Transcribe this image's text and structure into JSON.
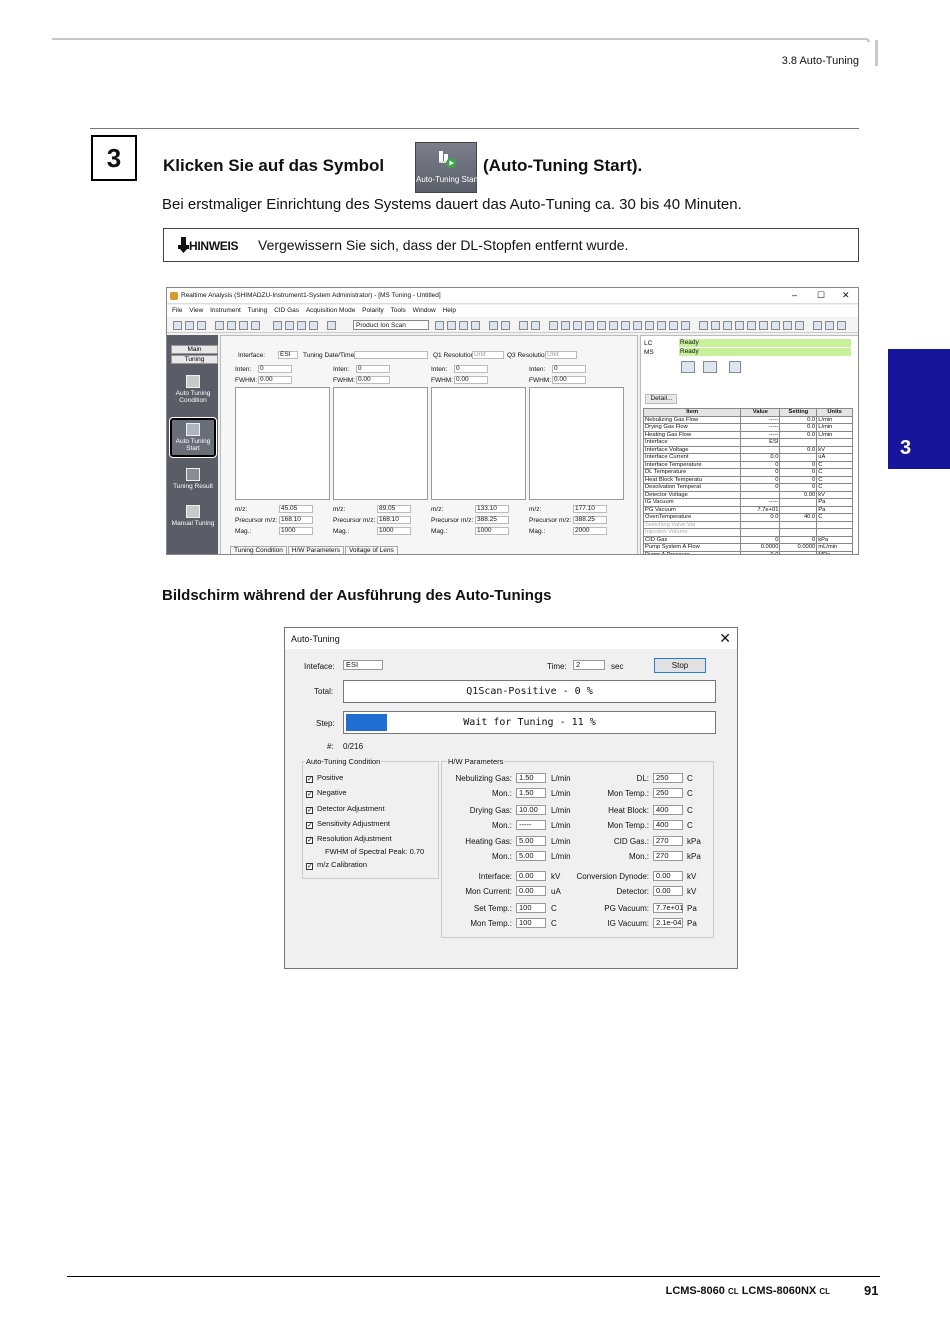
{
  "header": {
    "section": "3.8 Auto-Tuning"
  },
  "step": {
    "number": "3",
    "title_prefix": "Klicken Sie auf das Symbol",
    "icon_caption": "Auto-Tuning Start",
    "title_suffix": "(Auto-Tuning Start).",
    "intro": "Bei erstmaliger Einrichtung des Systems dauert das Auto-Tuning ca. 30 bis 40 Minuten."
  },
  "note": {
    "label": "HINWEIS",
    "text": "Vergewissern Sie sich, dass der DL-Stopfen entfernt wurde."
  },
  "window": {
    "title": "Realtime Analysis (SHIMADZU-Instrument1-System Administrator) - [MS Tuning - Untitled]",
    "controls": [
      "–",
      "☐",
      "✕"
    ],
    "menu": [
      "File",
      "View",
      "Instrument",
      "Tuning",
      "CID Gas",
      "Acquisition Mode",
      "Polarity",
      "Tools",
      "Window",
      "Help"
    ],
    "mode_select": "Product Ion Scan",
    "sidebar": {
      "tabs": [
        "Main",
        "Tuning"
      ],
      "items": [
        "Auto Tuning Condition",
        "Auto Tuning Start",
        "Tuning Result",
        "Manual Tuning"
      ]
    },
    "center": {
      "interface_label": "Interface:",
      "interface_value": "ESI",
      "date_label": "Tuning Date/Time:",
      "q1_label": "Q1 Resolution:",
      "q1_value": "Unit",
      "q3_label": "Q3 Resolution:",
      "q3_value": "Unit",
      "inten_label": "Inten:",
      "fwhm_label": "FWHM:",
      "mz_label": "m/z:",
      "precursor_label": "Precursor m/z:",
      "mag_label": "Mag.:",
      "panels": [
        {
          "inten": "0",
          "fwhm": "0.00",
          "mz": "45.05",
          "precursor": "168.10",
          "mag": "1000"
        },
        {
          "inten": "0",
          "fwhm": "0.00",
          "mz": "89.05",
          "precursor": "168.10",
          "mag": "1000"
        },
        {
          "inten": "0",
          "fwhm": "0.00",
          "mz": "133.10",
          "precursor": "388.25",
          "mag": "1000"
        },
        {
          "inten": "0",
          "fwhm": "0.00",
          "mz": "177.10",
          "precursor": "388.25",
          "mag": "2000"
        }
      ],
      "bottom_tabs": [
        "Tuning Condition",
        "H/W Parameters",
        "Voltage of Lens"
      ]
    },
    "right": {
      "lc_label": "LC",
      "lc_status": "Ready",
      "ms_label": "MS",
      "ms_status": "Ready",
      "detail_button": "Detail...",
      "columns": [
        "Item",
        "Value",
        "Setting",
        "Units"
      ],
      "rows": [
        [
          "Nebulizing Gas Flow",
          "-----",
          "0.0",
          "L/min"
        ],
        [
          "Drying Gas Flow",
          "-----",
          "0.0",
          "L/min"
        ],
        [
          "Heating Gas Flow",
          "-----",
          "0.0",
          "L/min"
        ],
        [
          "Interface",
          "ESI",
          "",
          ""
        ],
        [
          "Interface Voltage",
          "",
          "0.0",
          "kV"
        ],
        [
          "Interface Current",
          "0.0",
          "",
          "uA"
        ],
        [
          "Interface Temperature",
          "0",
          "0",
          "C"
        ],
        [
          "DL Temperature",
          "0",
          "0",
          "C"
        ],
        [
          "Heat Block Temperatu",
          "0",
          "0",
          "C"
        ],
        [
          "Desolvation Temperat",
          "0",
          "0",
          "C"
        ],
        [
          "Detector Voltage",
          "",
          "0.00",
          "kV"
        ],
        [
          "IG Vacuum",
          "-----",
          "",
          "Pa"
        ],
        [
          "PG Vacuum",
          "7.7e+01",
          "",
          "Pa"
        ],
        [
          "OvenTemperature",
          "0.0",
          "40.0",
          "C"
        ],
        [
          "Switching Valve Val",
          "",
          "",
          ""
        ],
        [
          "Injection Volume",
          "",
          "",
          ""
        ],
        [
          "CID Gas",
          "0",
          "0",
          "kPa"
        ],
        [
          "Pump System A Flow",
          "0.0000",
          "0.0000",
          "mL/min"
        ],
        [
          "Pump A Pressure",
          "0.0",
          "",
          "MPa"
        ]
      ]
    }
  },
  "caption": "Bildschirm während der Ausführung des Auto-Tunings",
  "dialog": {
    "title": "Auto-Tuning",
    "close": "✕",
    "interface_label": "Inteface:",
    "interface_value": "ESI",
    "time_label": "Time:",
    "time_value": "2",
    "time_unit": "sec",
    "stop_button": "Stop",
    "total_label": "Total:",
    "total_text": "Q1Scan-Positive - 0 %",
    "total_progress": 0,
    "step_label": "Step:",
    "step_text": "Wait for Tuning - 11 %",
    "step_progress": 11,
    "count_label": "#:",
    "count_value": "0/216",
    "condition_title": "Auto-Tuning Condition",
    "conditions": [
      {
        "label": "Positive",
        "checked": true
      },
      {
        "label": "Negative",
        "checked": true
      },
      {
        "label": "Detector Adjustment",
        "checked": true
      },
      {
        "label": "Sensitivity Adjustment",
        "checked": true
      },
      {
        "label": "Resolution Adjustment",
        "checked": true
      },
      {
        "label": "m/z Calibration",
        "checked": true
      }
    ],
    "fwhm_text": "FWHM of Spectral Peak: 0.70",
    "hw_title": "H/W Parameters",
    "hw_left": [
      {
        "label": "Nebulizing Gas:",
        "value": "1.50",
        "unit": "L/min"
      },
      {
        "label": "Mon.:",
        "value": "1.50",
        "unit": "L/min"
      },
      {
        "label": "Drying Gas:",
        "value": "10.00",
        "unit": "L/min"
      },
      {
        "label": "Mon.:",
        "value": "-----",
        "unit": "L/min"
      },
      {
        "label": "Heating Gas:",
        "value": "5.00",
        "unit": "L/min"
      },
      {
        "label": "Mon.:",
        "value": "5.00",
        "unit": "L/min"
      },
      {
        "label": "Interface:",
        "value": "0.00",
        "unit": "kV"
      },
      {
        "label": "Mon Current:",
        "value": "0.00",
        "unit": "uA"
      },
      {
        "label": "Set Temp.:",
        "value": "100",
        "unit": "C"
      },
      {
        "label": "Mon Temp.:",
        "value": "100",
        "unit": "C"
      }
    ],
    "hw_right": [
      {
        "label": "DL:",
        "value": "250",
        "unit": "C"
      },
      {
        "label": "Mon Temp.:",
        "value": "250",
        "unit": "C"
      },
      {
        "label": "Heat Block:",
        "value": "400",
        "unit": "C"
      },
      {
        "label": "Mon Temp.:",
        "value": "400",
        "unit": "C"
      },
      {
        "label": "CID Gas.:",
        "value": "270",
        "unit": "kPa"
      },
      {
        "label": "Mon.:",
        "value": "270",
        "unit": "kPa"
      },
      {
        "label": "Conversion Dynode:",
        "value": "0.00",
        "unit": "kV"
      },
      {
        "label": "Detector:",
        "value": "0.00",
        "unit": "kV"
      },
      {
        "label": "PG Vacuum:",
        "value": "7.7e+01",
        "unit": "Pa"
      },
      {
        "label": "IG Vacuum:",
        "value": "2.1e-04",
        "unit": "Pa"
      }
    ]
  },
  "side_tab": {
    "number": "3",
    "color": "#17169b"
  },
  "footer": {
    "model": "LCMS-8060",
    "model_suffix": "CL",
    "model2": "LCMS-8060NX",
    "model2_suffix": "CL",
    "page": "91"
  }
}
